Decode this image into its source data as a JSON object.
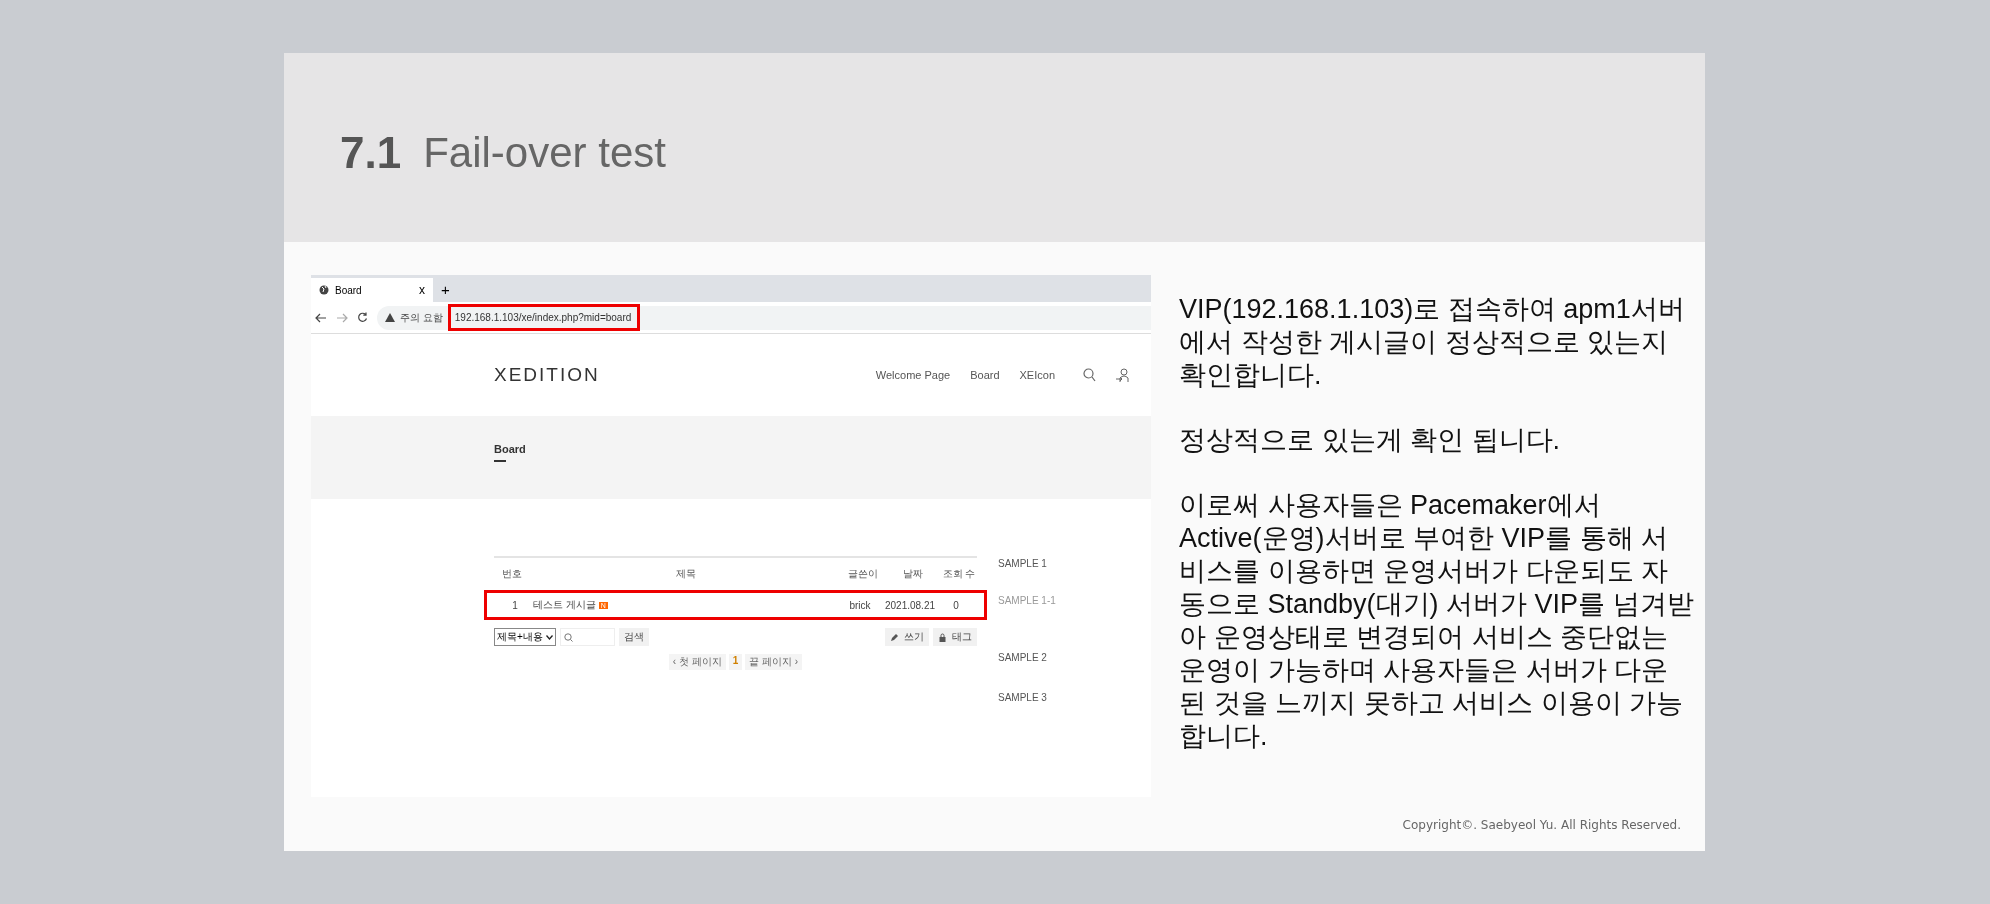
{
  "slide": {
    "number": "7.1",
    "title": "Fail-over test"
  },
  "browser": {
    "tab": {
      "title": "Board",
      "close": "x"
    },
    "new_tab": "+",
    "security": "주의 요함",
    "url": "192.168.1.103/xe/index.php?mid=board",
    "url_highlighted": true
  },
  "site": {
    "logo": "XEDITION",
    "nav": [
      "Welcome Page",
      "Board",
      "XEIcon"
    ],
    "page_title": "Board",
    "table": {
      "columns": [
        "번호",
        "제목",
        "글쓴이",
        "날짜",
        "조회 수"
      ],
      "rows": [
        {
          "number": "1",
          "title": "테스트 게시글",
          "badge": "N",
          "author": "brick",
          "date": "2021.08.21",
          "views": "0",
          "highlighted": true
        }
      ]
    },
    "search": {
      "option": "제목+내용",
      "button": "검색"
    },
    "actions": [
      "쓰기",
      "태그"
    ],
    "pagination": {
      "first": "‹ 첫 페이지",
      "current": "1",
      "last": "끝 페이지 ›"
    },
    "sidebar": [
      {
        "label": "SAMPLE 1",
        "children": [
          {
            "label": "SAMPLE 1-1"
          }
        ]
      },
      {
        "label": "SAMPLE 2"
      },
      {
        "label": "SAMPLE 3"
      }
    ]
  },
  "description": [
    "VIP(192.168.1.103)로 접속하여 apm1서버에서 작성한 게시글이 정상적으로 있는지 확인합니다.",
    "정상적으로 있는게 확인 됩니다.",
    "이로써 사용자들은 Pacemaker에서 Active(운영)서버로 부여한 VIP를 통해 서비스를 이용하면 운영서버가 다운되도 자동으로 Standby(대기) 서버가 VIP를 넘겨받아 운영상태로 변경되어 서비스 중단없는 운영이 가능하며 사용자들은 서버가 다운된 것을 느끼지 못하고 서비스 이용이 가능합니다."
  ],
  "copyright": "Copyright©. Saebyeol Yu. All Rights Reserved."
}
